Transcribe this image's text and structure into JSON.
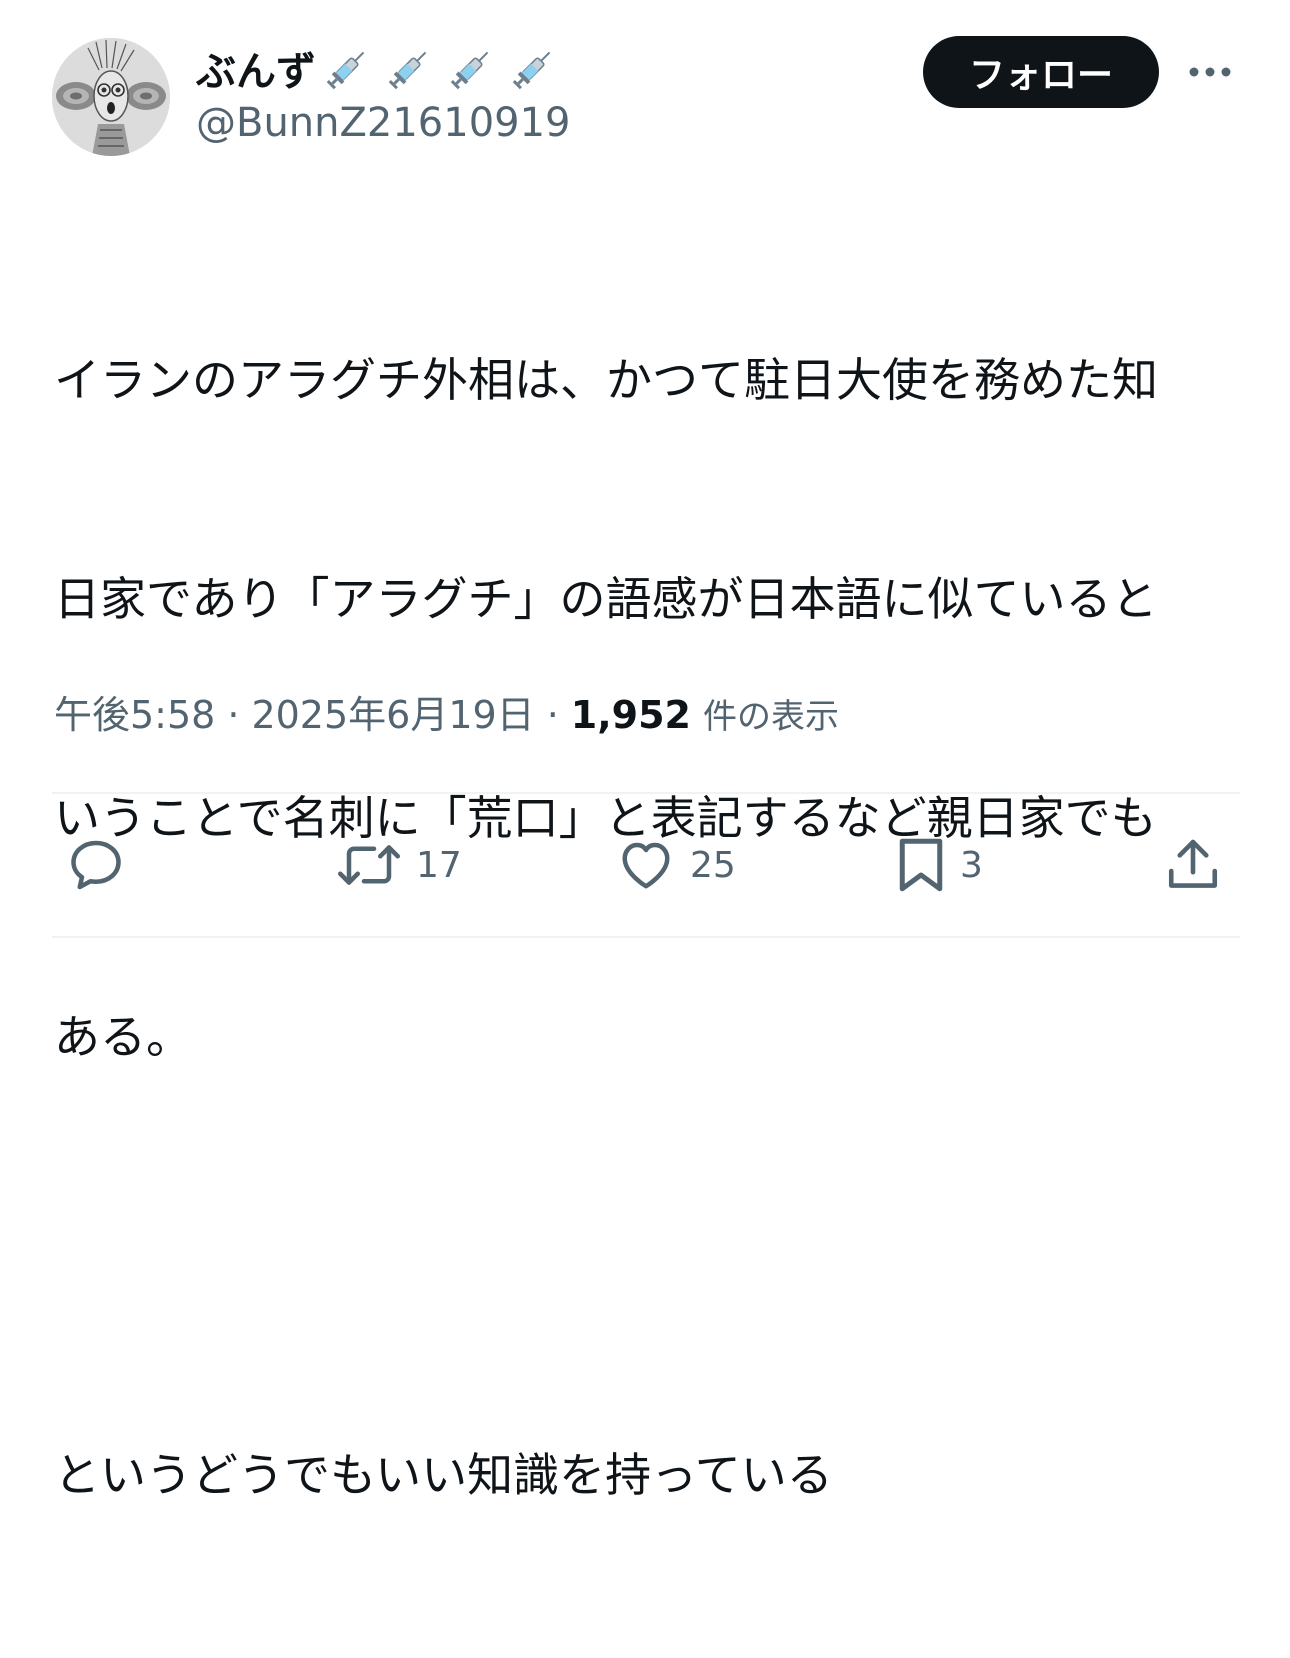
{
  "header": {
    "display_name": "ぶんず",
    "name_emojis": [
      "syringe-icon",
      "syringe-icon",
      "syringe-icon",
      "syringe-icon"
    ],
    "handle": "@BunnZ21610919",
    "follow_label": "フォロー"
  },
  "tweet": {
    "lines": [
      "イランのアラグチ外相は、かつて駐日大使を務めた知",
      "日家であり「アラグチ」の語感が日本語に似ていると",
      "いうことで名刺に「荒口」と表記するなど親日家でも",
      "ある。",
      "というどうでもいい知識を持っている"
    ]
  },
  "meta": {
    "time": "午後5:58",
    "separator": "·",
    "date": "2025年6月19日",
    "views_count": "1,952",
    "views_label": "件の表示"
  },
  "actions": {
    "reply_count": "",
    "retweet_count": "17",
    "like_count": "25",
    "bookmark_count": "3"
  },
  "colors": {
    "text_primary": "#0f1419",
    "text_secondary": "#536471",
    "follow_bg": "#0f1419",
    "divider": "#eff3f4"
  }
}
